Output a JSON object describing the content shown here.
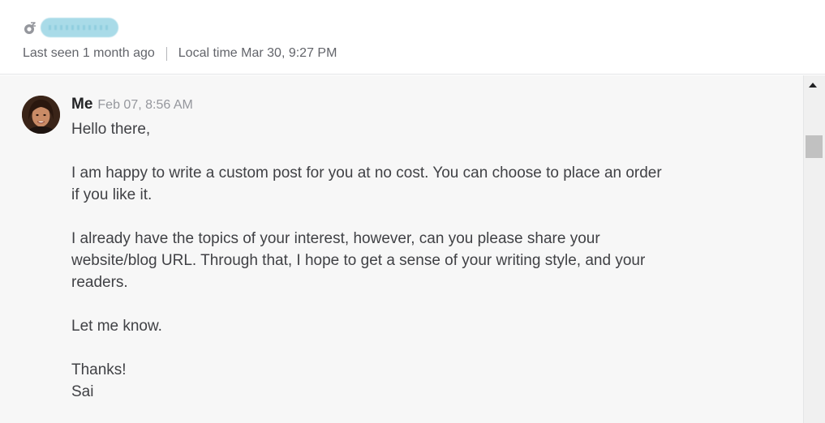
{
  "header": {
    "status_icon": "offline-status-icon",
    "last_seen": "Last seen 1 month ago",
    "local_time": "Local time Mar 30, 9:27 PM"
  },
  "message": {
    "avatar_icon": "user-avatar",
    "sender": "Me",
    "timestamp": "Feb 07, 8:56 AM",
    "paragraphs": [
      "Hello there,",
      "I am happy to write a custom post for you at no cost. You can choose to place an order if you like it.",
      "I already have the topics of your interest, however, can you please share your website/blog URL. Through that, I hope to get a sense of your writing style, and your readers.",
      "Let me know.",
      "Thanks!",
      "Sai"
    ]
  },
  "scrollbar": {
    "up_arrow_icon": "scroll-up-arrow-icon"
  }
}
